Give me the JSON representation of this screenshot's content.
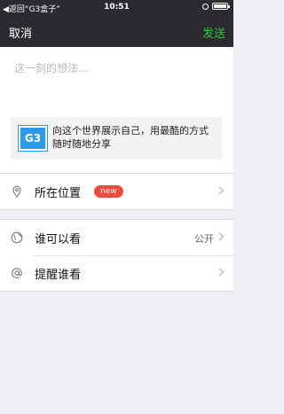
{
  "status_bar": {
    "back_text": "◀返回“G3盒子”",
    "time": "10:51"
  },
  "nav": {
    "cancel_label": "取消",
    "send_label": "发送"
  },
  "compose": {
    "placeholder": "这一刻的想法..."
  },
  "share_card": {
    "logo_text": "G3",
    "description": "向这个世界展示自己，用最酷的方式随时随地分享"
  },
  "location": {
    "label": "所在位置",
    "badge": "new"
  },
  "privacy": {
    "label": "谁可以看",
    "value": "公开"
  },
  "mention": {
    "label": "提醒谁看"
  },
  "colors": {
    "accent": "#38c13f",
    "badge": "#f04b3b",
    "brand": "#2b9ae9"
  }
}
